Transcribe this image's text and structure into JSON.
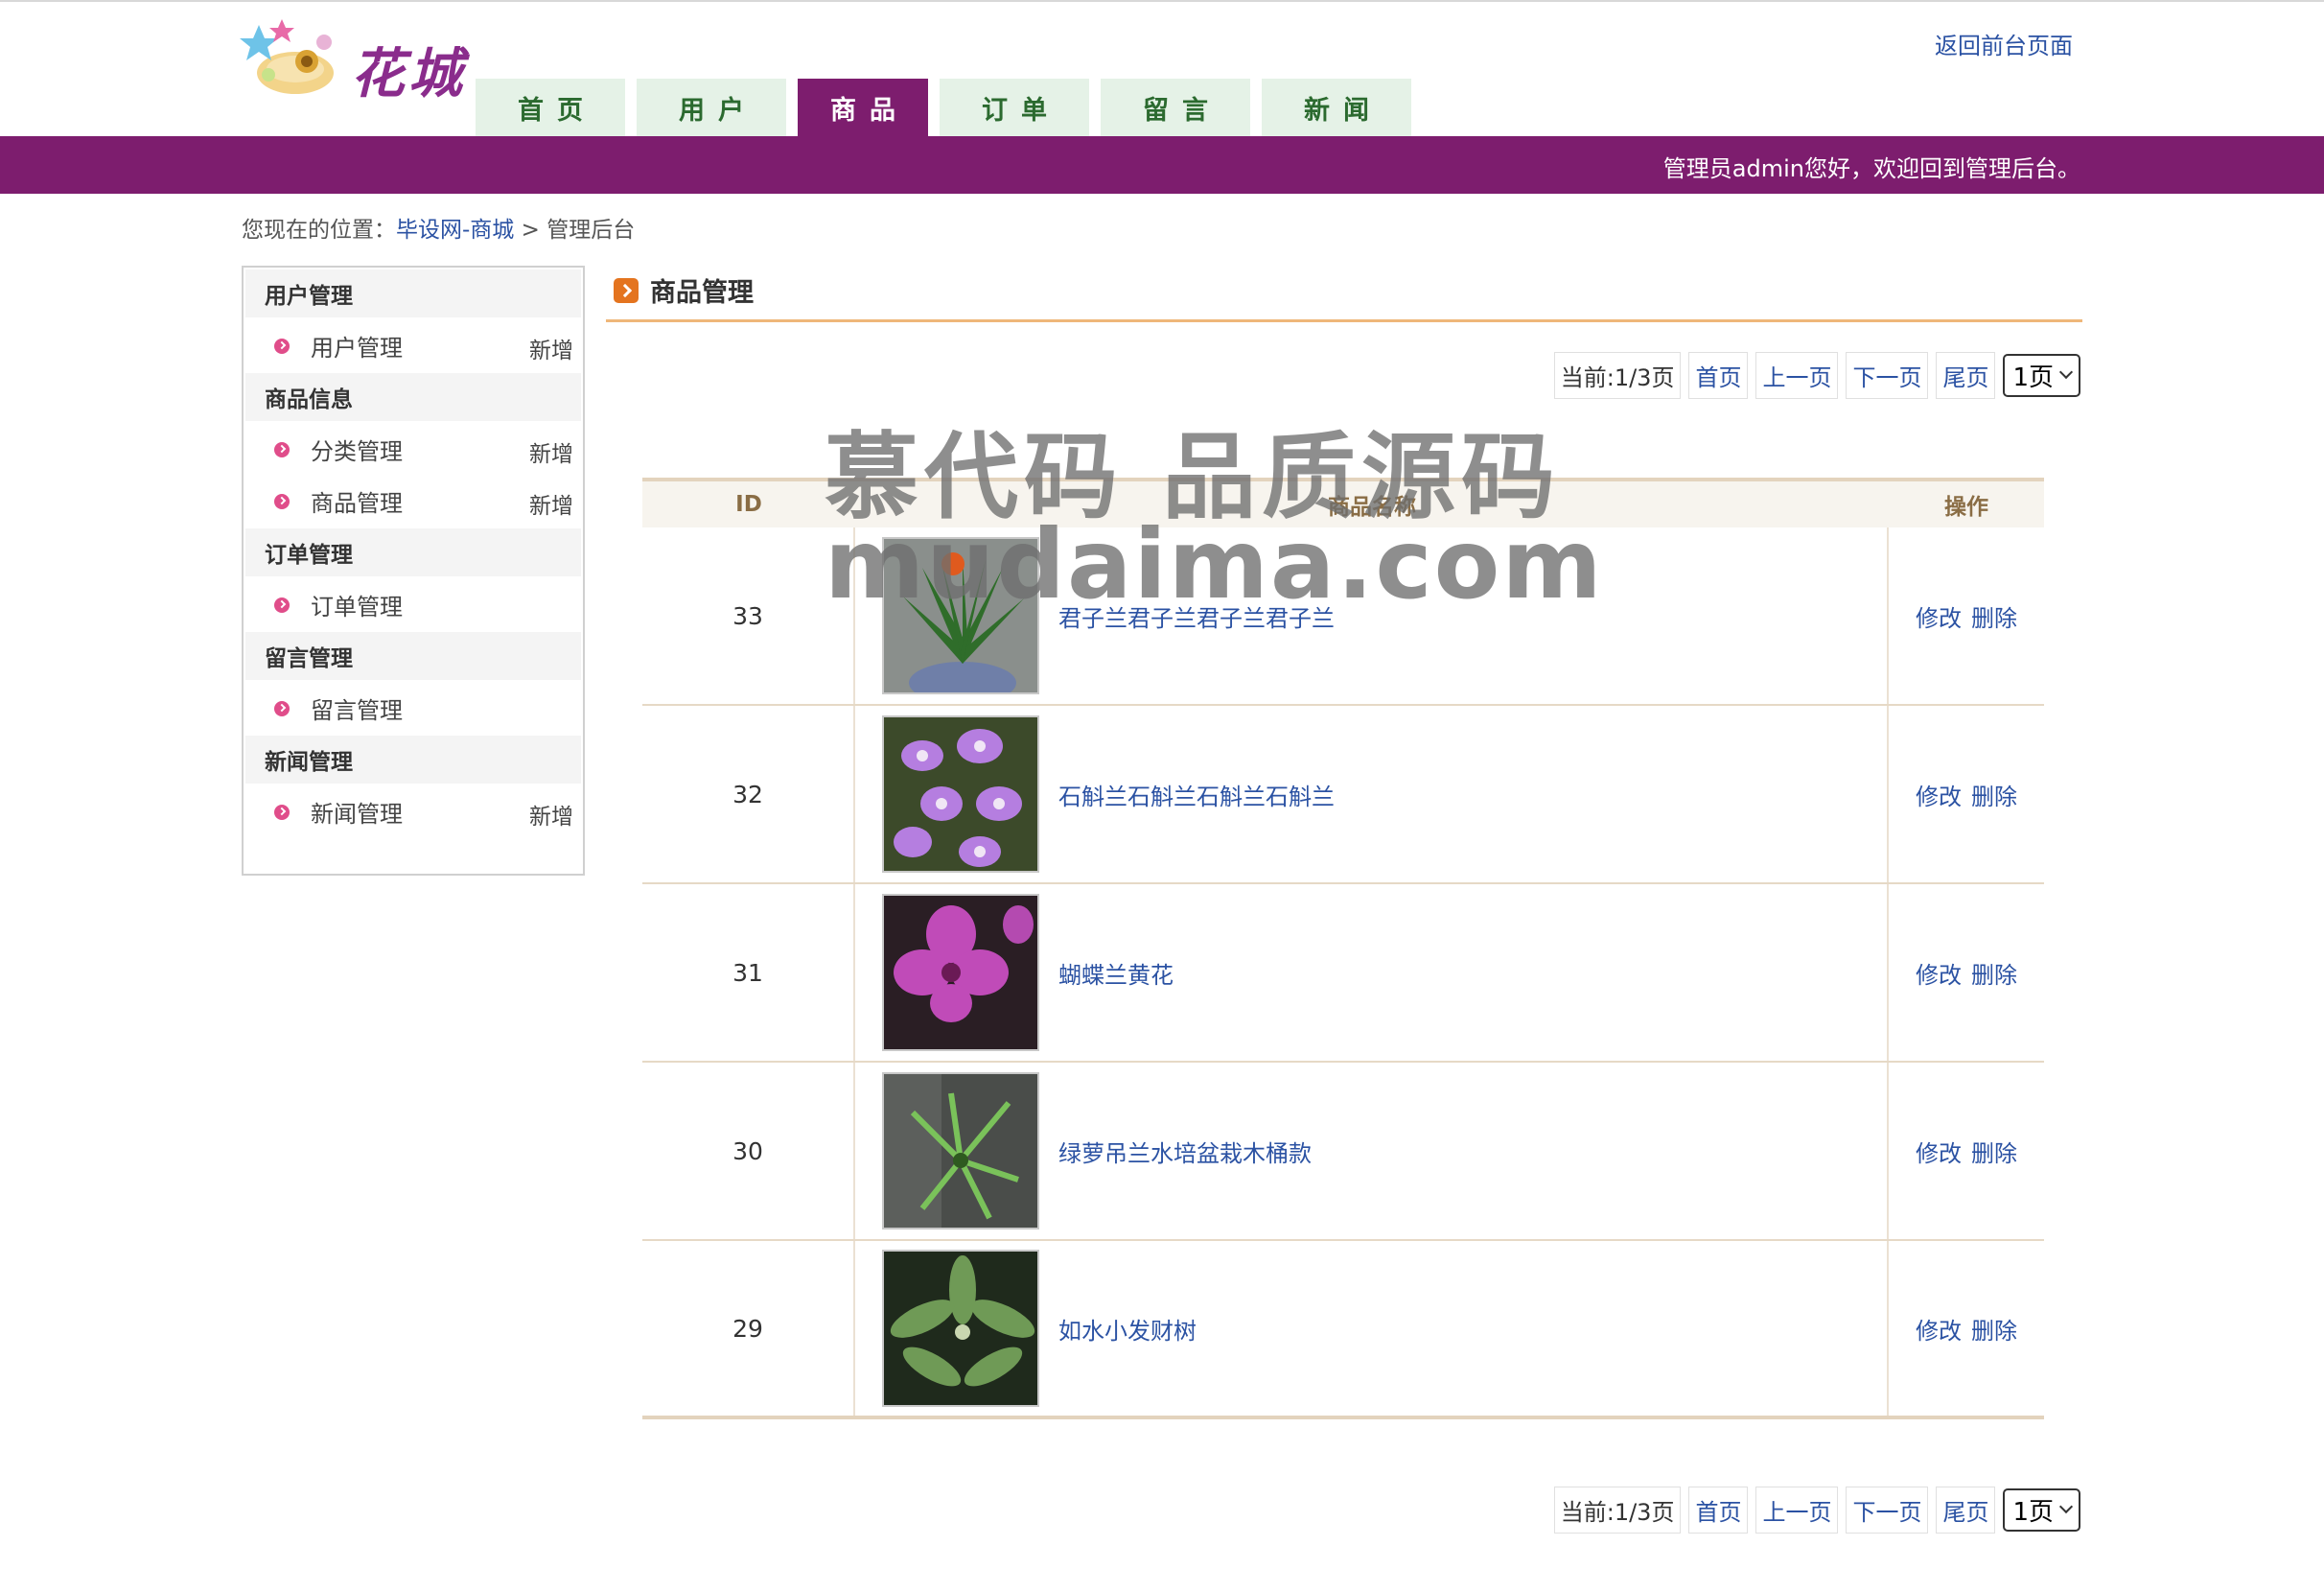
{
  "header": {
    "logo_text": "花城",
    "front_link": "返回前台页面",
    "nav": [
      {
        "label": "首页",
        "active": false
      },
      {
        "label": "用户",
        "active": false
      },
      {
        "label": "商品",
        "active": true
      },
      {
        "label": "订单",
        "active": false
      },
      {
        "label": "留言",
        "active": false
      },
      {
        "label": "新闻",
        "active": false
      }
    ],
    "welcome": "管理员admin您好，欢迎回到管理后台。"
  },
  "breadcrumb": {
    "prefix": "您现在的位置：",
    "site_link": "毕设网-商城",
    "separator": ">",
    "current": "管理后台"
  },
  "sidebar": {
    "groups": [
      {
        "title": "用户管理",
        "items": [
          {
            "label": "用户管理",
            "add": "新增"
          }
        ]
      },
      {
        "title": "商品信息",
        "items": [
          {
            "label": "分类管理",
            "add": "新增"
          },
          {
            "label": "商品管理",
            "add": "新增"
          }
        ]
      },
      {
        "title": "订单管理",
        "items": [
          {
            "label": "订单管理",
            "add": ""
          }
        ]
      },
      {
        "title": "留言管理",
        "items": [
          {
            "label": "留言管理",
            "add": ""
          }
        ]
      },
      {
        "title": "新闻管理",
        "items": [
          {
            "label": "新闻管理",
            "add": "新增"
          }
        ]
      }
    ]
  },
  "main": {
    "title": "商品管理",
    "pager": {
      "current": "当前:1/3页",
      "first": "首页",
      "prev": "上一页",
      "next": "下一页",
      "last": "尾页",
      "select_value": "1页"
    },
    "table": {
      "headers": {
        "id": "ID",
        "name": "商品名称",
        "op": "操作"
      },
      "rows": [
        {
          "id": "33",
          "name": "君子兰君子兰君子兰君子兰",
          "edit": "修改",
          "delete": "删除"
        },
        {
          "id": "32",
          "name": "石斛兰石斛兰石斛兰石斛兰",
          "edit": "修改",
          "delete": "删除"
        },
        {
          "id": "31",
          "name": "蝴蝶兰黄花",
          "edit": "修改",
          "delete": "删除"
        },
        {
          "id": "30",
          "name": "绿萝吊兰水培盆栽木桶款",
          "edit": "修改",
          "delete": "删除"
        },
        {
          "id": "29",
          "name": "如水小发财树",
          "edit": "修改",
          "delete": "删除"
        }
      ]
    }
  },
  "watermark": {
    "line1": "慕代码 品质源码",
    "line2": "mudaima.com"
  },
  "colors": {
    "brand_purple": "#7d1d6e",
    "nav_tab_bg": "#e5f2e7",
    "link_blue": "#2b52a3",
    "title_underline": "#efb77a"
  }
}
